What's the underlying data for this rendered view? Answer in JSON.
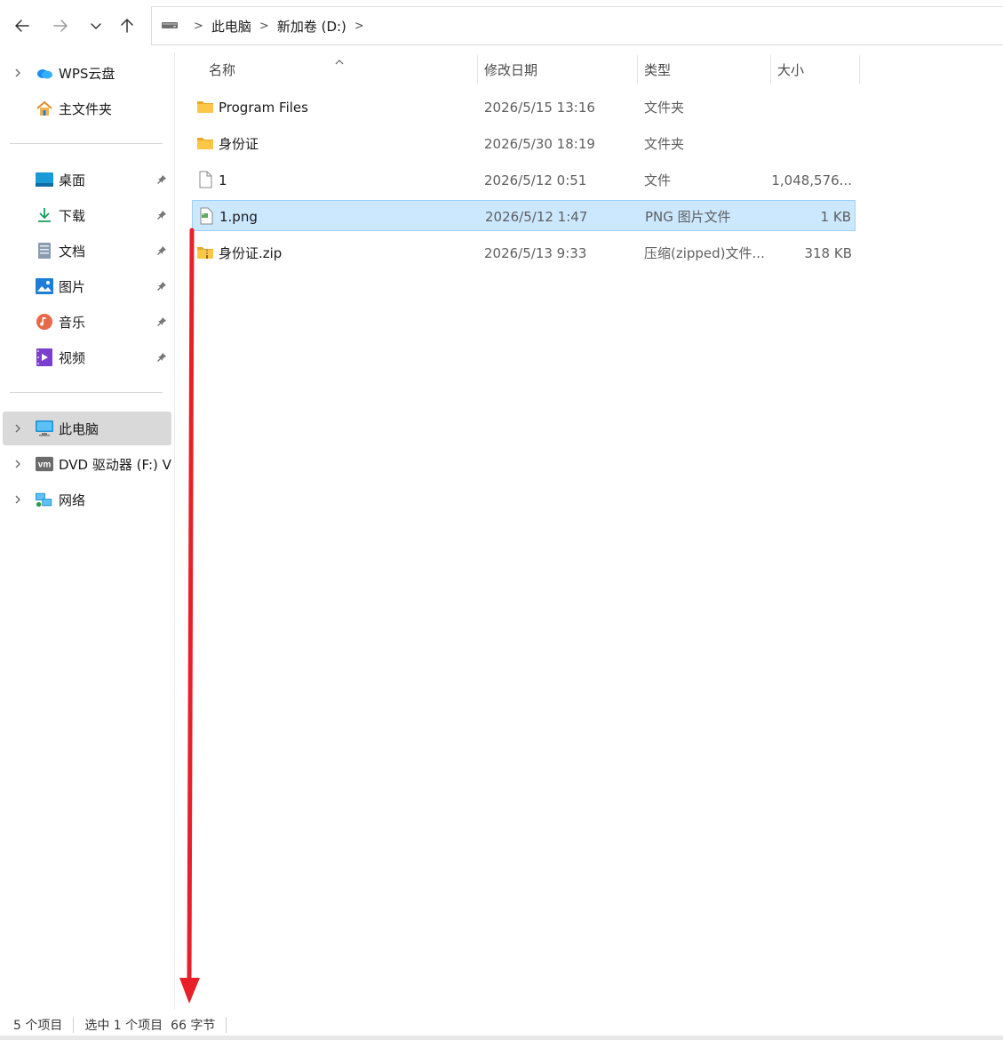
{
  "nav": {
    "back": "back-arrow",
    "forward": "forward-arrow",
    "recent": "chevron-down",
    "up": "up-arrow"
  },
  "breadcrumb": {
    "items": [
      "此电脑",
      "新加卷 (D:)"
    ],
    "sep": ">"
  },
  "sidebar": {
    "items": [
      {
        "label": "WPS云盘",
        "icon": "cloud-icon"
      },
      {
        "label": "主文件夹",
        "icon": "home-icon"
      },
      {
        "label": "桌面",
        "icon": "desktop-icon"
      },
      {
        "label": "下载",
        "icon": "download-icon"
      },
      {
        "label": "文档",
        "icon": "document-icon"
      },
      {
        "label": "图片",
        "icon": "pictures-icon"
      },
      {
        "label": "音乐",
        "icon": "music-icon"
      },
      {
        "label": "视频",
        "icon": "video-icon"
      },
      {
        "label": "此电脑",
        "icon": "computer-icon"
      },
      {
        "label": "DVD 驱动器 (F:) VM",
        "icon": "vm-drive-icon"
      },
      {
        "label": "网络",
        "icon": "network-icon"
      }
    ]
  },
  "columns": {
    "name": "名称",
    "date": "修改日期",
    "type": "类型",
    "size": "大小"
  },
  "files": [
    {
      "name": "Program Files",
      "date": "2026/5/15 13:16",
      "type": "文件夹",
      "size": "",
      "icon": "folder-icon"
    },
    {
      "name": "身份证",
      "date": "2026/5/30 18:19",
      "type": "文件夹",
      "size": "",
      "icon": "folder-icon"
    },
    {
      "name": "1",
      "date": "2026/5/12 0:51",
      "type": "文件",
      "size": "1,048,576...",
      "icon": "file-icon"
    },
    {
      "name": "1.png",
      "date": "2026/5/12 1:47",
      "type": "PNG 图片文件",
      "size": "1 KB",
      "icon": "png-file-icon"
    },
    {
      "name": "身份证.zip",
      "date": "2026/5/13 9:33",
      "type": "压缩(zipped)文件...",
      "size": "318 KB",
      "icon": "zip-folder-icon"
    }
  ],
  "status": {
    "count": "5 个项目",
    "selected": "选中 1 个项目",
    "size": "66 字节"
  },
  "colors": {
    "selection": "#cce8ff",
    "selection_border": "#99d1ff",
    "annotation": "#e8202a"
  }
}
